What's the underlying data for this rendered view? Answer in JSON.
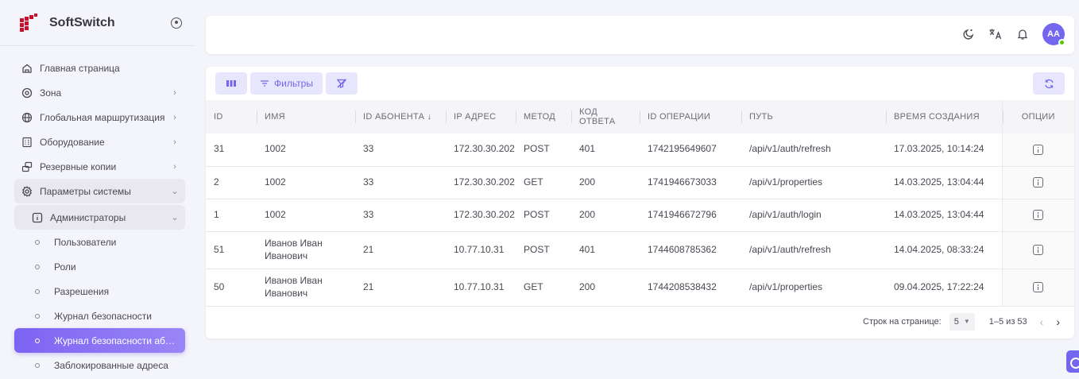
{
  "brand": {
    "name": "SoftSwitch"
  },
  "sidebar": {
    "items": [
      {
        "label": "Главная страница",
        "icon": "home-icon"
      },
      {
        "label": "Зона",
        "icon": "location-pin-icon"
      },
      {
        "label": "Глобальная маршрутизация",
        "icon": "globe-icon"
      },
      {
        "label": "Оборудование",
        "icon": "server-icon"
      },
      {
        "label": "Резервные копии",
        "icon": "backup-icon"
      },
      {
        "label": "Параметры системы",
        "icon": "gear-icon"
      },
      {
        "label": "Администраторы",
        "icon": "info-square-icon"
      },
      {
        "label": "Пользователи"
      },
      {
        "label": "Роли"
      },
      {
        "label": "Разрешения"
      },
      {
        "label": "Журнал безопасности"
      },
      {
        "label": "Журнал безопасности абон..."
      },
      {
        "label": "Заблокированные адреса"
      }
    ]
  },
  "topbar": {
    "avatar_initials": "AA"
  },
  "toolbar": {
    "filters_label": "Фильтры"
  },
  "table": {
    "headers": [
      "ID",
      "ИМЯ",
      "ID АБОНЕНТА ↓",
      "IP АДРЕС",
      "МЕТОД",
      "КОД ОТВЕТА",
      "ID ОПЕРАЦИИ",
      "ПУТЬ",
      "ВРЕМЯ СОЗДАНИЯ",
      "ОПЦИИ"
    ],
    "rows": [
      [
        "31",
        "1002",
        "33",
        "172.30.30.202",
        "POST",
        "401",
        "1742195649607",
        "/api/v1/auth/refresh",
        "17.03.2025, 10:14:24"
      ],
      [
        "2",
        "1002",
        "33",
        "172.30.30.202",
        "GET",
        "200",
        "1741946673033",
        "/api/v1/properties",
        "14.03.2025, 13:04:44"
      ],
      [
        "1",
        "1002",
        "33",
        "172.30.30.202",
        "POST",
        "200",
        "1741946672796",
        "/api/v1/auth/login",
        "14.03.2025, 13:04:44"
      ],
      [
        "51",
        "Иванов Иван Иванович",
        "21",
        "10.77.10.31",
        "POST",
        "401",
        "1744608785362",
        "/api/v1/auth/refresh",
        "14.04.2025, 08:33:24"
      ],
      [
        "50",
        "Иванов Иван Иванович",
        "21",
        "10.77.10.31",
        "GET",
        "200",
        "1744208538432",
        "/api/v1/properties",
        "09.04.2025, 17:22:24"
      ]
    ]
  },
  "pagination": {
    "rows_per_page_label": "Строк на странице:",
    "rows_per_page": "5",
    "range": "1–5 из 53"
  },
  "colors": {
    "accent": "#7367f0",
    "online": "#56ca00"
  }
}
